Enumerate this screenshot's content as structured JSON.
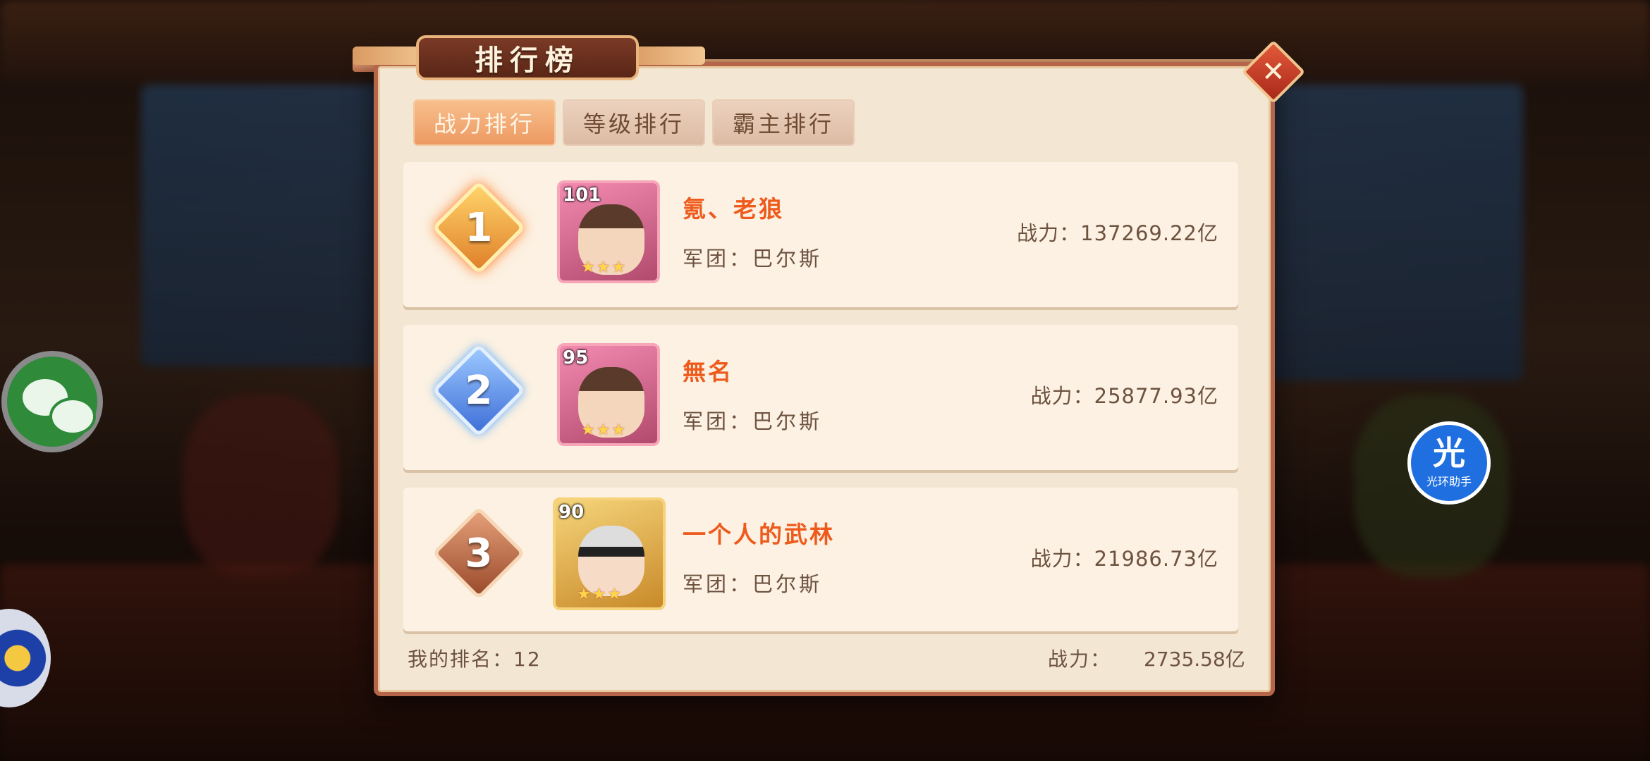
{
  "panel": {
    "title": "排行榜",
    "close_label": "✕"
  },
  "tabs": [
    {
      "label": "战力排行",
      "active": true
    },
    {
      "label": "等级排行",
      "active": false
    },
    {
      "label": "霸主排行",
      "active": false
    }
  ],
  "rankings": [
    {
      "rank": "1",
      "level": "101",
      "name": "氪、老狼",
      "guild": "军团：巴尔斯",
      "power": "战力：137269.22亿",
      "stars": "★★★"
    },
    {
      "rank": "2",
      "level": "95",
      "name": "無名",
      "guild": "军团：巴尔斯",
      "power": "战力：25877.93亿",
      "stars": "★★★"
    },
    {
      "rank": "3",
      "level": "90",
      "name": "一个人的武林",
      "guild": "军团：巴尔斯",
      "power": "战力：21986.73亿",
      "stars": "★★★"
    }
  ],
  "footer": {
    "my_rank": "我的排名：12",
    "power_label": "战力：",
    "power_value": "2735.58亿"
  },
  "widgets": {
    "helper_big": "光",
    "helper_small": "光环助手"
  },
  "colors": {
    "accent_orange": "#ee5a1c",
    "panel_border": "#b5664a",
    "tab_active": "#ee9a62"
  }
}
